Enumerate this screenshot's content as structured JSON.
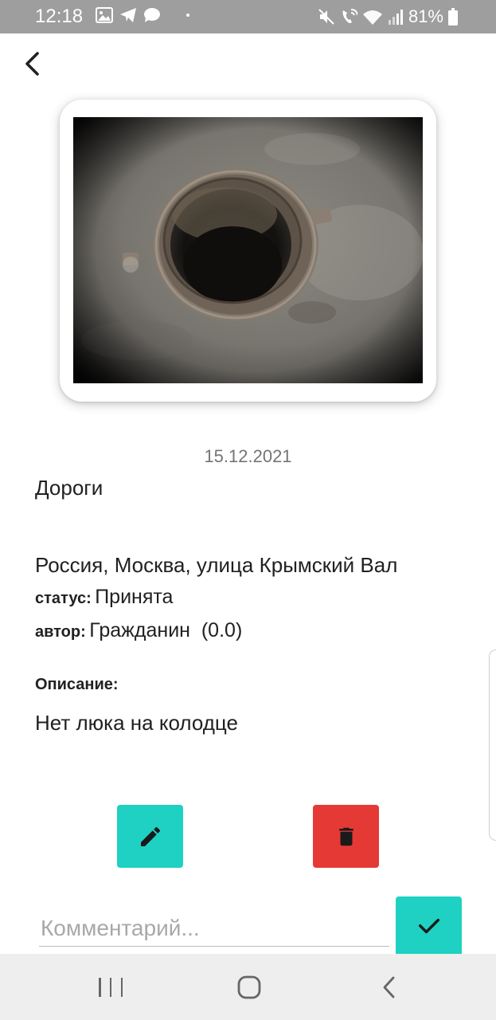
{
  "status_bar": {
    "time": "12:18",
    "battery": "81%",
    "icons": [
      "image-icon",
      "telegram-icon",
      "chat-icon",
      "dot-icon",
      "mute-icon",
      "wifi-call-icon",
      "wifi-icon",
      "signal-icon",
      "battery-icon"
    ]
  },
  "header": {
    "back_icon": "chevron-left-icon"
  },
  "report": {
    "date": "15.12.2021",
    "category": "Дороги",
    "address": "Россия, Москва, улица Крымский Вал",
    "status_label": "статус:",
    "status_value": "Принята",
    "author_label": "автор:",
    "author_value": "Гражданин  (0.0)",
    "description_label": "Описание:",
    "description_text": "Нет люка на колодце"
  },
  "actions": {
    "edit_icon": "pencil-icon",
    "delete_icon": "trash-icon"
  },
  "comment": {
    "placeholder": "Комментарий...",
    "value": "",
    "submit_icon": "check-icon"
  },
  "colors": {
    "accent": "#1ed1c2",
    "danger": "#e53935",
    "status_bar": "#9e9e9e",
    "nav_bar": "#eeeeee"
  },
  "nav_bar": {
    "icons": [
      "recents-icon",
      "home-icon",
      "back-icon"
    ]
  }
}
